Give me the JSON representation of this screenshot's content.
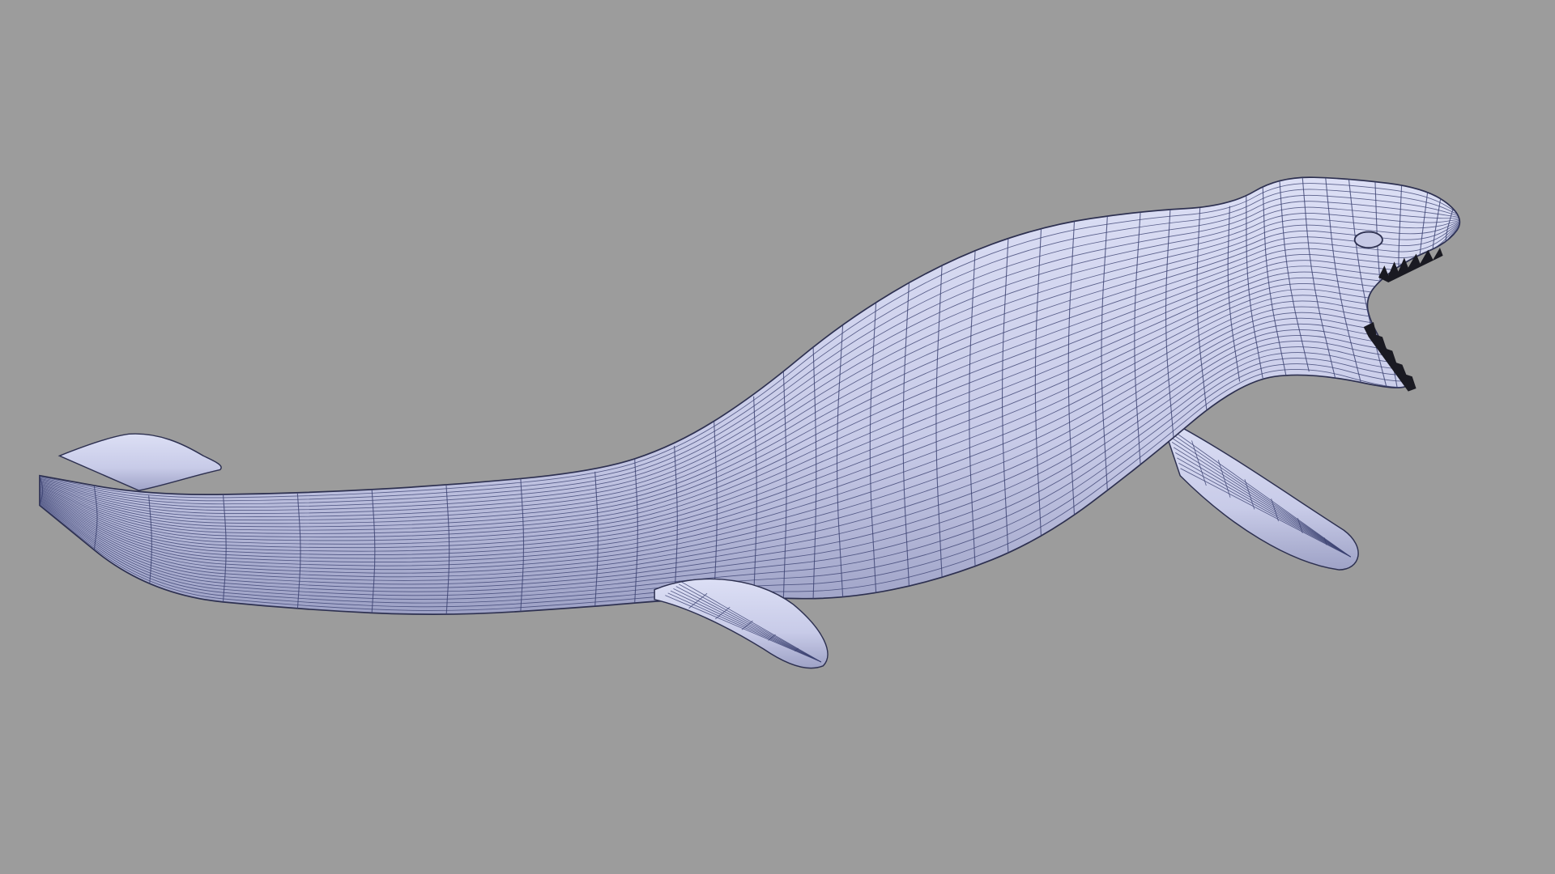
{
  "scene": {
    "subject": "mosasaur",
    "colors": {
      "background": "#9c9c9c",
      "body_light": "#d4d7f0",
      "body_dark": "#a9adcf",
      "wire": "#3b4170",
      "teeth": "#1a1a22"
    }
  }
}
